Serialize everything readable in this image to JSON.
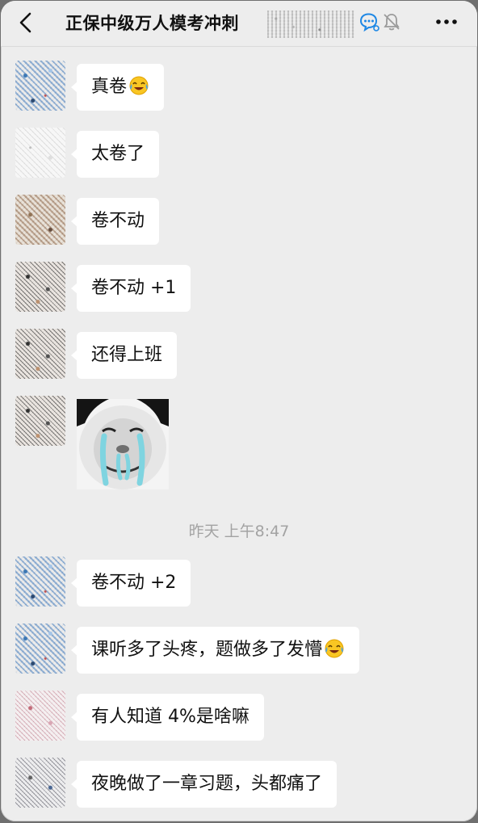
{
  "header": {
    "title": "正保中级万人模考冲刺",
    "back_icon": "chevron-left-icon",
    "chat_icon": "chat-search-icon",
    "mute_icon": "bell-off-icon",
    "more_icon": "more-dots-icon"
  },
  "messages": [
    {
      "text": "真卷",
      "emoji": "laugh-cry-emoji"
    },
    {
      "text": "太卷了"
    },
    {
      "text": "卷不动"
    },
    {
      "text": "卷不动 +1"
    },
    {
      "text": "还得上班"
    },
    {
      "type": "sticker",
      "sticker": "crying-panda-meme"
    }
  ],
  "timestamp": "昨天 上午8:47",
  "messages_after": [
    {
      "text": "卷不动 +2"
    },
    {
      "text": "课听多了头疼，题做多了发懵",
      "emoji": "laugh-cry-emoji"
    },
    {
      "text": "有人知道 4%是啥嘛"
    },
    {
      "text": "夜晚做了一章习题，头都痛了"
    }
  ],
  "colors": {
    "background": "#ededed",
    "bubble": "#ffffff",
    "timestamp_text": "#a3a3a3",
    "accent_blue": "#1e88e5"
  }
}
